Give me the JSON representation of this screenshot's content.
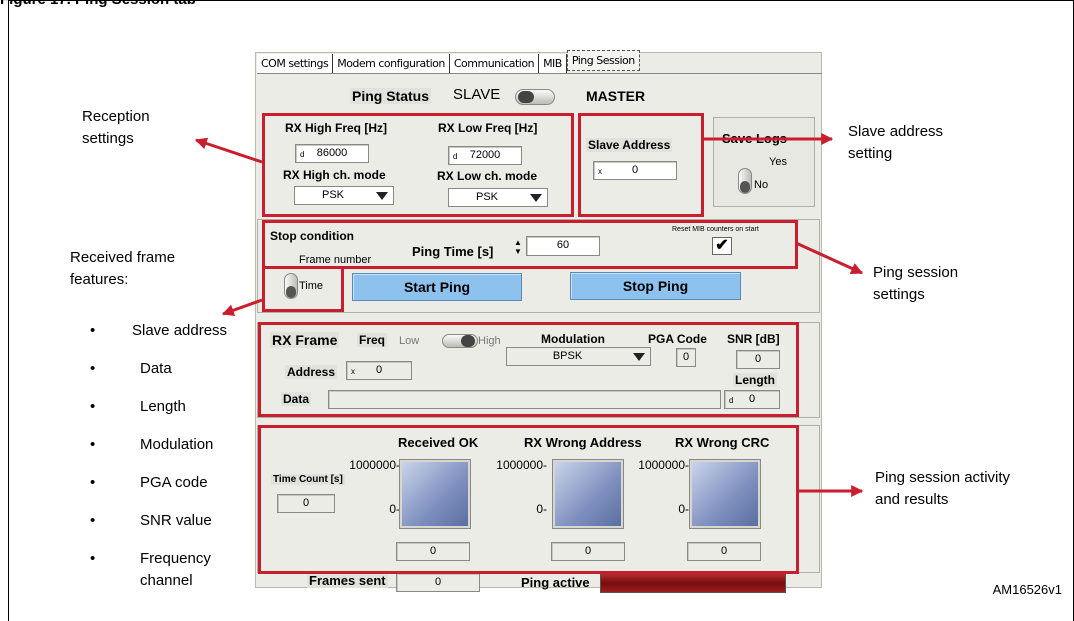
{
  "figure": {
    "title": "Figure 17. Ping Session tab",
    "id": "AM16526v1"
  },
  "annotations": {
    "reception": "Reception\nsettings",
    "slave_address": "Slave address\nsetting",
    "ping_session_settings": "Ping session\nsettings",
    "received_frame": "Received frame\nfeatures:",
    "activity": "Ping session activity\nand results",
    "bullets": [
      "Slave address",
      "Data",
      "Length",
      "Modulation",
      "PGA code",
      "SNR value",
      "Frequency\nchannel"
    ],
    "bullet_char": "•"
  },
  "tabs": [
    "COM settings",
    "Modem configuration",
    "Communication",
    "MIB",
    "Ping Session"
  ],
  "status": {
    "label": "Ping Status",
    "left": "SLAVE",
    "right": "MASTER",
    "mode": "SLAVE"
  },
  "reception": {
    "rx_high_freq_label": "RX High Freq [Hz]",
    "rx_high_freq_radix": "d",
    "rx_high_freq_value": "86000",
    "rx_low_freq_label": "RX Low Freq [Hz]",
    "rx_low_freq_radix": "d",
    "rx_low_freq_value": "72000",
    "rx_high_mode_label": "RX High ch. mode",
    "rx_high_mode_value": "PSK",
    "rx_low_mode_label": "RX Low ch. mode",
    "rx_low_mode_value": "PSK"
  },
  "slave": {
    "label": "Slave Address",
    "radix": "x",
    "value": "0"
  },
  "save_logs": {
    "label": "Save Logs",
    "yes": "Yes",
    "no": "No",
    "state": "No"
  },
  "session": {
    "stop_label": "Stop condition",
    "frame_number": "Frame number",
    "time": "Time",
    "ping_time_label": "Ping Time [s]",
    "ping_time_value": "60",
    "reset_mib_label": "Reset MIB counters on start",
    "reset_mib_checked": "✔",
    "start_button": "Start Ping",
    "stop_button": "Stop Ping"
  },
  "rx_frame": {
    "title": "RX Frame",
    "freq_label": "Freq",
    "freq_low": "Low",
    "freq_high": "High",
    "modulation_label": "Modulation",
    "modulation_value": "BPSK",
    "pga_label": "PGA Code",
    "pga_value": "0",
    "snr_label": "SNR [dB]",
    "snr_value": "0",
    "address_label": "Address",
    "address_radix": "x",
    "address_value": "0",
    "length_label": "Length",
    "length_radix": "d",
    "length_value": "0",
    "data_label": "Data",
    "data_value": ""
  },
  "results": {
    "time_count_label": "Time Count [s]",
    "time_count_value": "0",
    "received_ok_label": "Received OK",
    "wrong_address_label": "RX Wrong Address",
    "wrong_crc_label": "RX Wrong CRC",
    "scale_max": "1000000-",
    "scale_min": "0-",
    "received_ok_value": "0",
    "wrong_address_value": "0",
    "wrong_crc_value": "0",
    "frames_sent_label": "Frames sent",
    "frames_sent_value": "0",
    "ping_active_label": "Ping active"
  },
  "colors": {
    "highlight": "#c81e2e",
    "button": "#8ec2ee",
    "indicator": "#9a1e1e"
  }
}
